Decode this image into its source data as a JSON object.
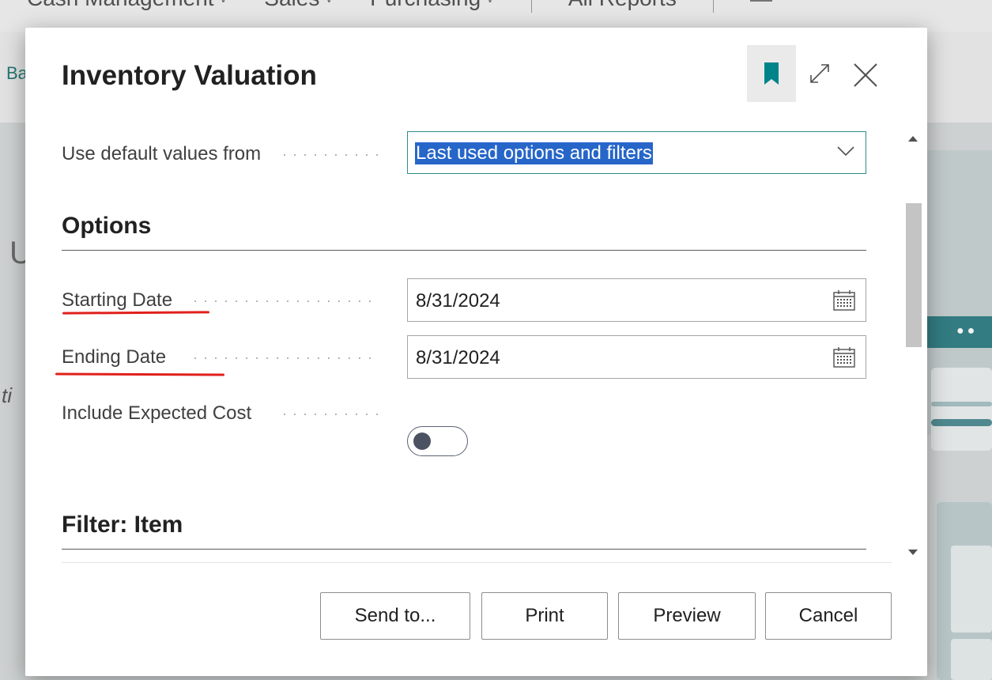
{
  "background": {
    "nav_items": [
      {
        "label": "Cash Management"
      },
      {
        "label": "Sales"
      },
      {
        "label": "Purchasing"
      }
    ],
    "all_reports": "All Reports",
    "breadcrumb_fragment": "Ba",
    "left_fragment_u": "U",
    "left_fragment_ti": "ti"
  },
  "dialog": {
    "title": "Inventory Valuation",
    "bookmark_icon": "bookmark-icon",
    "expand_icon": "expand-icon",
    "close_icon": "close-icon",
    "default_values": {
      "label": "Use default values from",
      "value": "Last used options and filters"
    },
    "options": {
      "section_title": "Options",
      "starting_date": {
        "label": "Starting Date",
        "value": "8/31/2024"
      },
      "ending_date": {
        "label": "Ending Date",
        "value": "8/31/2024"
      },
      "include_expected_cost": {
        "label": "Include Expected Cost",
        "value": false
      }
    },
    "filter_section_title": "Filter: Item",
    "buttons": {
      "send_to": "Send to...",
      "print": "Print",
      "preview": "Preview",
      "cancel": "Cancel"
    }
  },
  "colors": {
    "accent": "#008489",
    "selection": "#2766c9",
    "annotation_red": "#e0201b"
  }
}
